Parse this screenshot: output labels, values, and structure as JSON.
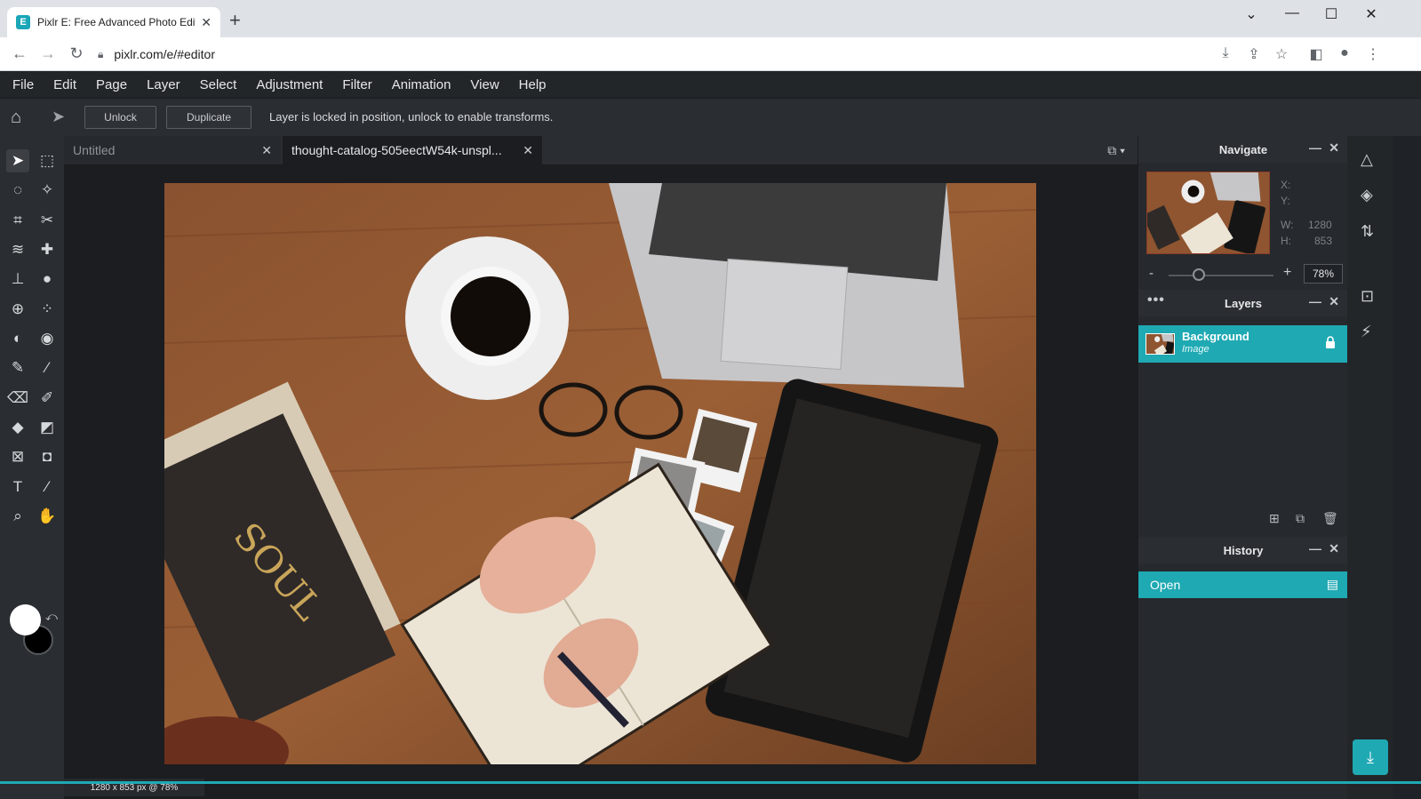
{
  "browser": {
    "tab_title": "Pixlr E: Free Advanced Photo Edit",
    "favicon_letter": "E",
    "tab_close": "✕",
    "new_tab": "+",
    "url": "pixlr.com/e/#editor",
    "controls": {
      "minimize": "—",
      "maximize": "☐",
      "close": "✕",
      "dropdown": "⌄"
    }
  },
  "menu": [
    "File",
    "Edit",
    "Page",
    "Layer",
    "Select",
    "Adjustment",
    "Filter",
    "Animation",
    "View",
    "Help"
  ],
  "toolbar": {
    "unlock_label": "Unlock",
    "duplicate_label": "Duplicate",
    "message": "Layer is locked in position, unlock to enable transforms."
  },
  "doc_tabs": [
    {
      "label": "Untitled",
      "close": "✕"
    },
    {
      "label": "thought-catalog-505eectW54k-unspl...",
      "close": "✕"
    }
  ],
  "status": {
    "text": "1280 x 853 px @ 78%"
  },
  "navigate": {
    "title": "Navigate",
    "x_label": "X:",
    "y_label": "Y:",
    "w_label": "W:",
    "w_value": "1280",
    "h_label": "H:",
    "h_value": "853",
    "zoom_minus": "-",
    "zoom_plus": "+",
    "zoom_value": "78%",
    "zoom_fraction": 0.78
  },
  "layers": {
    "title": "Layers",
    "items": [
      {
        "name": "Background",
        "type": "Image",
        "locked": true
      }
    ]
  },
  "history": {
    "title": "History",
    "items": [
      {
        "label": "Open"
      }
    ]
  },
  "panel_controls": {
    "minimize": "—",
    "close": "✕",
    "more": "•••"
  },
  "colors": {
    "accent": "#1fa9b3",
    "foreground": "#ffffff",
    "background": "#000000"
  },
  "icons": {
    "tools": [
      "arrange-icon",
      "marquee-icon",
      "lasso-icon",
      "wand-icon",
      "crop-icon",
      "cutout-icon",
      "liquify-icon",
      "heal-icon",
      "clone-icon",
      "blur-icon",
      "sponge-icon",
      "pixelate-icon",
      "dodge-icon",
      "burn-icon",
      "pencil-icon",
      "brush-icon",
      "eraser-icon",
      "color-replace-icon",
      "fill-icon",
      "gradient-icon",
      "frame-icon",
      "shape-icon",
      "text-icon",
      "eyedropper-icon",
      "zoom-icon",
      "hand-icon"
    ],
    "side": [
      "adjust-icon",
      "layers-icon",
      "history-icon",
      "fit-icon",
      "ai-icon"
    ]
  }
}
